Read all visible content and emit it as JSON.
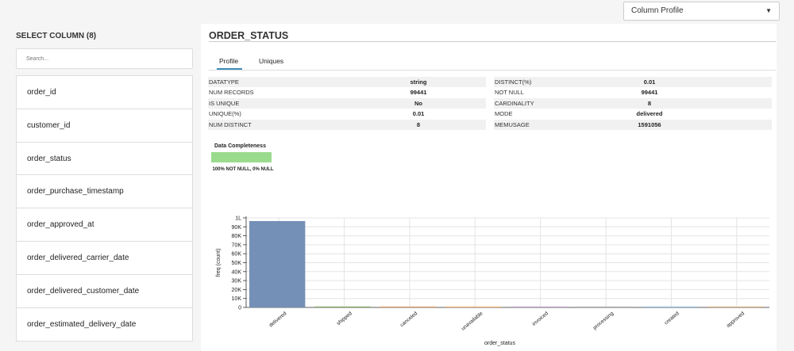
{
  "topbar": {
    "view_select": "Column Profile"
  },
  "left": {
    "title": "SELECT COLUMN (8)",
    "search_placeholder": "Search...",
    "columns": [
      "order_id",
      "customer_id",
      "order_status",
      "order_purchase_timestamp",
      "order_approved_at",
      "order_delivered_carrier_date",
      "order_delivered_customer_date",
      "order_estimated_delivery_date"
    ]
  },
  "main": {
    "title": "ORDER_STATUS",
    "tabs": [
      "Profile",
      "Uniques"
    ],
    "active_tab": "Profile",
    "stats_left": [
      {
        "name": "DATATYPE",
        "value": "string"
      },
      {
        "name": "NUM RECORDS",
        "value": "99441"
      },
      {
        "name": "IS UNIQUE",
        "value": "No"
      },
      {
        "name": "UNIQUE(%)",
        "value": "0.01"
      },
      {
        "name": "NUM DISTINCT",
        "value": "8"
      }
    ],
    "stats_right": [
      {
        "name": "DISTINCT(%)",
        "value": "0.01"
      },
      {
        "name": "NOT NULL",
        "value": "99441"
      },
      {
        "name": "CARDINALITY",
        "value": "8"
      },
      {
        "name": "MODE",
        "value": "delivered"
      },
      {
        "name": "MEMUSAGE",
        "value": "1591056"
      }
    ],
    "completeness": {
      "title": "Data Completeness",
      "label": "100% NOT NULL, 0% NULL",
      "not_null_fraction": 1.0
    }
  },
  "colors": {
    "bar_fill": "#7590b7",
    "completeness_fill": "#9bdb8e",
    "tab_underline": "#3c8dbc"
  },
  "chart_data": {
    "type": "bar",
    "xlabel": "order_status",
    "ylabel": "freq (count)",
    "categories": [
      "delivered",
      "shipped",
      "canceled",
      "unavailable",
      "invoiced",
      "processing",
      "created",
      "approved"
    ],
    "values": [
      96478,
      1107,
      625,
      609,
      314,
      301,
      5,
      2
    ],
    "bar_colors": [
      "#7590b7",
      "#8fb06e",
      "#e8a36b",
      "#f0b77a",
      "#c2a6d1",
      "#b4b4b4",
      "#9ec0e0",
      "#d9b38c"
    ],
    "yticks": [
      "0",
      "10K",
      "20K",
      "30K",
      "40K",
      "50K",
      "60K",
      "70K",
      "80K",
      "90K",
      "1L"
    ],
    "ylim": [
      0,
      100000
    ],
    "grid": true
  }
}
